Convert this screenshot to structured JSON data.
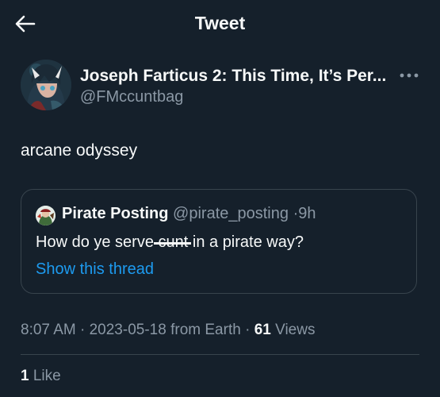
{
  "header": {
    "title": "Tweet",
    "back_icon": "arrow-left-icon"
  },
  "author": {
    "display_name": "Joseph Farticus 2: This Time, It’s Per...",
    "handle": "@FMccuntbag",
    "avatar_icon": "avatar-icon",
    "more_icon": "more-horizontal-icon"
  },
  "tweet": {
    "text": "arcane odyssey"
  },
  "quote": {
    "display_name": "Pirate Posting",
    "handle": "@pirate_posting",
    "separator": "·",
    "time": "9h",
    "text_before": "How do ye serve ",
    "text_struck": "cunt",
    "text_after": " in a pirate way?",
    "show_thread": "Show this thread"
  },
  "meta": {
    "time": "8:07 AM",
    "date": "2023-05-18",
    "source": "from Earth",
    "views_count": "61",
    "views_label": "Views"
  },
  "stats": {
    "likes_count": "1",
    "likes_label": "Like"
  },
  "colors": {
    "background": "#15202b",
    "text": "#f7f9f9",
    "secondary": "#8b98a5",
    "accent": "#1d9bf0",
    "border": "#38444d"
  }
}
